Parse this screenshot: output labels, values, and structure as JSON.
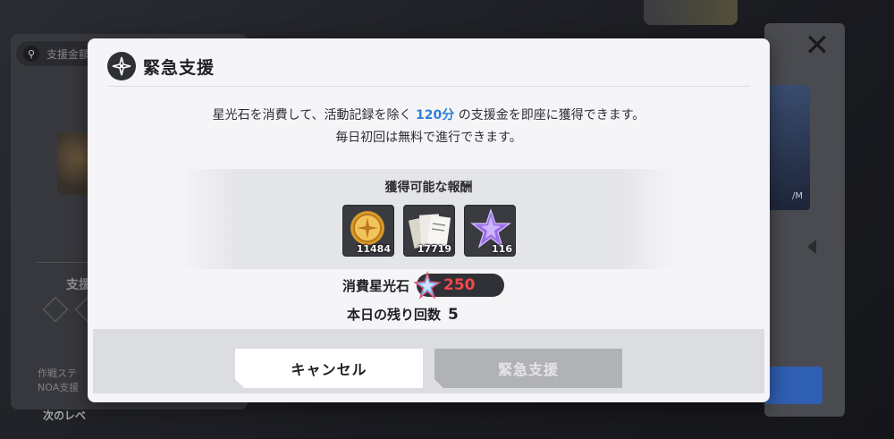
{
  "background": {
    "search_label": "支援金額",
    "panel_heading": "支援",
    "panel_desc_1": "作戦ステ",
    "panel_desc_2": "NOA支援",
    "panel_next": "次のレベ",
    "right_card_text": "/M"
  },
  "dialog": {
    "title": "緊急支援",
    "description": {
      "line1_pre": "星光石を消費して、活動記録を除く ",
      "line1_highlight": "120分",
      "line1_post": " の支援金を即座に獲得できます。",
      "line2": "毎日初回は無料で進行できます。"
    },
    "rewards": {
      "title": "獲得可能な報酬",
      "items": [
        {
          "icon": "gold-coin-icon",
          "count": "11484"
        },
        {
          "icon": "activity-report-icon",
          "count": "17719"
        },
        {
          "icon": "purple-crystal-icon",
          "count": "116"
        }
      ]
    },
    "cost": {
      "label": "消費星光石",
      "icon": "star-crystal-icon",
      "value": "250"
    },
    "remaining": {
      "label": "本日の残り回数",
      "value": "5"
    },
    "buttons": {
      "cancel": "キャンセル",
      "confirm": "緊急支援"
    }
  },
  "close_label": "✕",
  "colors": {
    "highlight": "#2f7fd8",
    "cost_value": "#f0474d",
    "dialog_bg": "#f5f5f7",
    "disabled_button": "#b1b2b6"
  }
}
